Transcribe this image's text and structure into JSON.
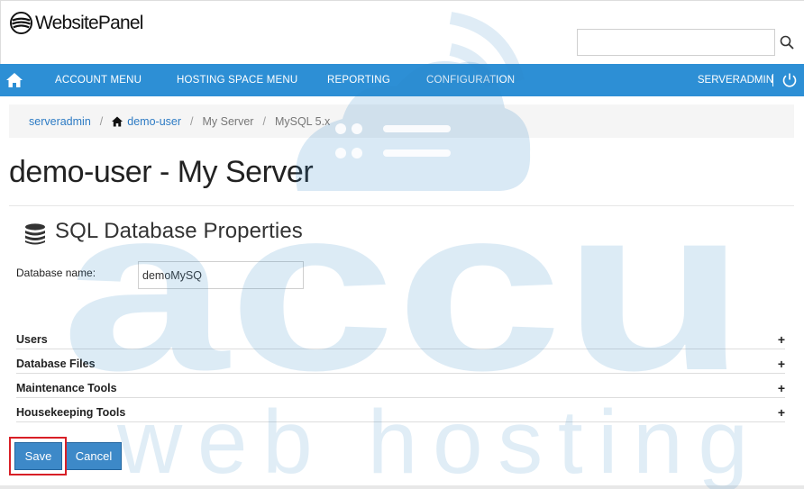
{
  "header": {
    "logo_text": "WebsitePanel",
    "search_placeholder": ""
  },
  "nav": {
    "items": [
      {
        "label": "ACCOUNT MENU"
      },
      {
        "label": "HOSTING SPACE MENU"
      },
      {
        "label": "REPORTING"
      },
      {
        "label": "CONFIGURATION"
      }
    ],
    "user": "SERVERADMIN",
    "separator": "|"
  },
  "breadcrumb": {
    "items": [
      "serveradmin",
      "demo-user",
      "My Server",
      "MySQL 5.x"
    ],
    "separator": "/"
  },
  "page": {
    "title": "demo-user - My Server",
    "section_title": "SQL Database Properties"
  },
  "form": {
    "database_name_label": "Database name:",
    "database_name_value": "demoMySQ"
  },
  "collapsibles": [
    {
      "label": "Users",
      "toggle": "+"
    },
    {
      "label": "Database Files",
      "toggle": "+"
    },
    {
      "label": "Maintenance Tools",
      "toggle": "+"
    },
    {
      "label": "Housekeeping Tools",
      "toggle": "+"
    }
  ],
  "buttons": {
    "save": "Save",
    "cancel": "Cancel"
  },
  "watermark": {
    "line1": "accu",
    "line2": "web hosting"
  },
  "colors": {
    "nav_bg": "#2d8fd5",
    "button_bg": "#3d89c8",
    "highlight": "#d81f26",
    "link": "#2d7bc4"
  }
}
